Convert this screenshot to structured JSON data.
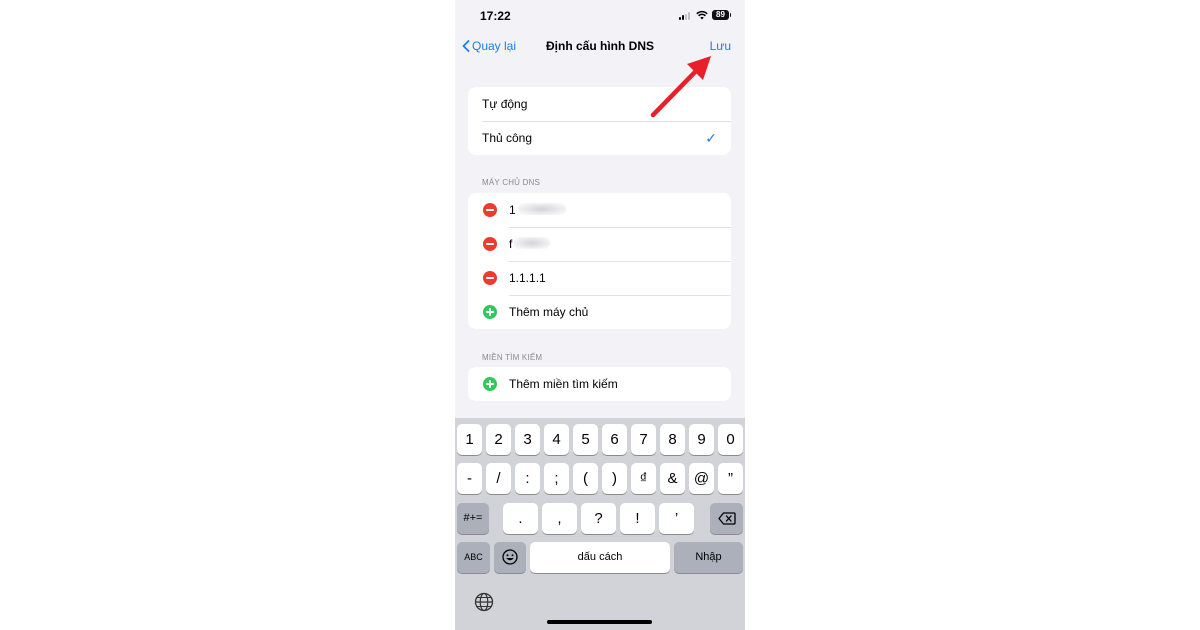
{
  "status_bar": {
    "time": "17:22",
    "battery": "89"
  },
  "nav": {
    "back_label": "Quay lại",
    "title": "Định cấu hình DNS",
    "save_label": "Lưu"
  },
  "config_mode": {
    "options": [
      "Tự động",
      "Thủ công"
    ],
    "selected": "Thủ công",
    "check": "✓"
  },
  "dns_servers": {
    "section_label": "MÁY CHỦ DNS",
    "items": [
      "1",
      "f",
      "1.1.1.1"
    ],
    "add_label": "Thêm máy chủ"
  },
  "search_domains": {
    "section_label": "MIỀN TÌM KIẾM",
    "add_label": "Thêm miền tìm kiếm"
  },
  "keyboard": {
    "row1": [
      "1",
      "2",
      "3",
      "4",
      "5",
      "6",
      "7",
      "8",
      "9",
      "0"
    ],
    "row2": [
      "-",
      "/",
      ":",
      ";",
      "(",
      ")",
      "₫",
      "&",
      "@",
      "”"
    ],
    "row3_left": "#+=",
    "row3": [
      ".",
      ",",
      "?",
      "!",
      "’"
    ],
    "abc": "ABC",
    "space": "dấu cách",
    "return": "Nhập"
  },
  "annotation": {
    "arrow_color": "#e8202a"
  },
  "colors": {
    "accent": "#1a7ff2",
    "delete": "#ee3b30",
    "add": "#34c759"
  }
}
